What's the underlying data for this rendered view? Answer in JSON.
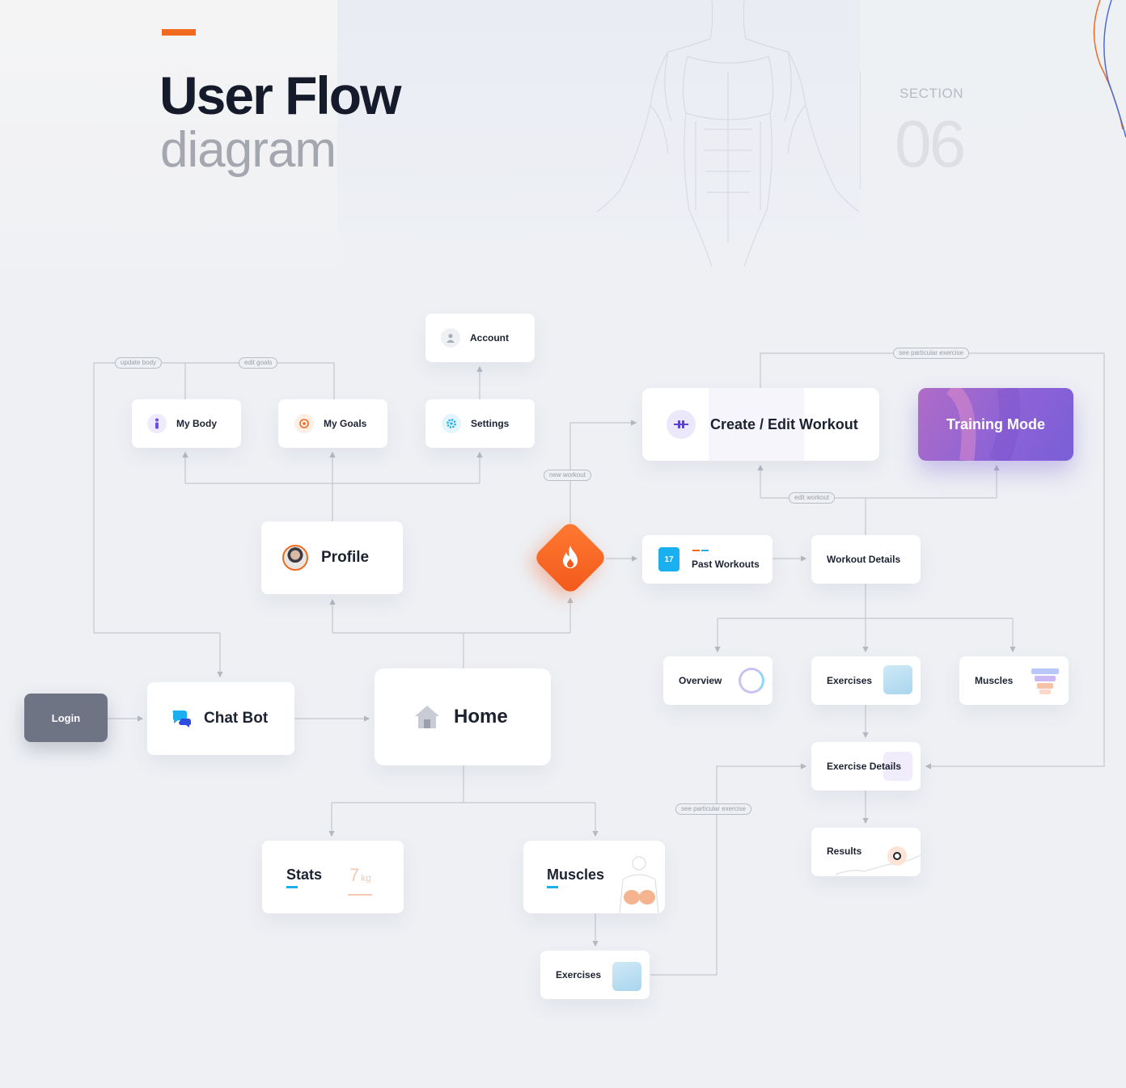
{
  "header": {
    "title": "User Flow",
    "subtitle": "diagram",
    "section_label": "SECTION",
    "section_number": "06"
  },
  "colors": {
    "accent": "#f26a21",
    "login": "#6e7484",
    "blue": "#1ab0f0",
    "purple": "#7a5ed8",
    "connector": "#c4c7ce"
  },
  "tags": {
    "update_body": "update body",
    "edit_goals": "edit goals",
    "new_workout": "new workout",
    "edit_workout": "edit workout",
    "see_exercise_top": "see particular exercise",
    "see_exercise_bottom": "see particular exercise"
  },
  "nodes": {
    "login": "Login",
    "chat_bot": "Chat Bot",
    "home": "Home",
    "profile": "Profile",
    "my_body": "My Body",
    "my_goals": "My Goals",
    "settings": "Settings",
    "account": "Account",
    "stats": "Stats",
    "stats_value": "7",
    "stats_unit": "kg",
    "muscles_main": "Muscles",
    "exercises_bottom": "Exercises",
    "create_edit_workout": "Create / Edit Workout",
    "training_mode": "Training Mode",
    "past_workouts": "Past Workouts",
    "past_workouts_day": "17",
    "workout_details": "Workout Details",
    "overview": "Overview",
    "exercises": "Exercises",
    "muscles": "Muscles",
    "exercise_details": "Exercise Details",
    "results": "Results"
  },
  "icons": {
    "my_body": "body-icon",
    "my_goals": "target-icon",
    "settings": "gear-icon",
    "account": "user-icon",
    "chat_bot": "chat-bubbles-icon",
    "home": "house-icon",
    "profile": "avatar",
    "workout": "dumbbell-icon",
    "hub": "flame-icon",
    "past_workouts": "calendar-icon"
  }
}
